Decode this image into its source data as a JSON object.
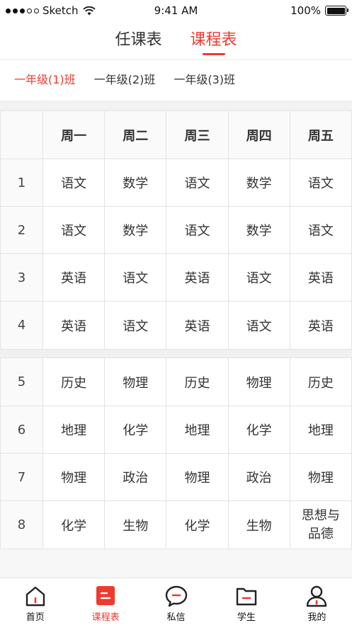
{
  "status_bar": {
    "carrier": "Sketch",
    "time": "9:41 AM",
    "battery": "100%"
  },
  "top_tabs": [
    {
      "label": "任课表",
      "active": false
    },
    {
      "label": "课程表",
      "active": true
    }
  ],
  "class_tabs": [
    {
      "label": "一年级(1)班",
      "active": true
    },
    {
      "label": "一年级(2)班",
      "active": false
    },
    {
      "label": "一年级(3)班",
      "active": false
    }
  ],
  "schedule": {
    "days": [
      "周一",
      "周二",
      "周三",
      "周四",
      "周五"
    ],
    "morning": [
      {
        "period": "1",
        "courses": [
          "语文",
          "数学",
          "语文",
          "数学",
          "语文"
        ]
      },
      {
        "period": "2",
        "courses": [
          "语文",
          "数学",
          "语文",
          "数学",
          "语文"
        ]
      },
      {
        "period": "3",
        "courses": [
          "英语",
          "语文",
          "英语",
          "语文",
          "英语"
        ]
      },
      {
        "period": "4",
        "courses": [
          "英语",
          "语文",
          "英语",
          "语文",
          "英语"
        ]
      }
    ],
    "afternoon": [
      {
        "period": "5",
        "courses": [
          "历史",
          "物理",
          "历史",
          "物理",
          "历史"
        ]
      },
      {
        "period": "6",
        "courses": [
          "地理",
          "化学",
          "地理",
          "化学",
          "地理"
        ]
      },
      {
        "period": "7",
        "courses": [
          "物理",
          "政治",
          "物理",
          "政治",
          "物理"
        ]
      },
      {
        "period": "8",
        "courses": [
          "化学",
          "生物",
          "化学",
          "生物",
          "思想与\n品德"
        ]
      }
    ]
  },
  "bottom_nav": [
    {
      "label": "首页",
      "icon": "home-icon",
      "active": false
    },
    {
      "label": "课程表",
      "icon": "schedule-icon",
      "active": true
    },
    {
      "label": "私信",
      "icon": "message-icon",
      "active": false
    },
    {
      "label": "学生",
      "icon": "folder-icon",
      "active": false
    },
    {
      "label": "我的",
      "icon": "profile-icon",
      "active": false
    }
  ],
  "colors": {
    "accent": "#f03a2e",
    "text": "#333333",
    "border": "#e3e3e3"
  }
}
